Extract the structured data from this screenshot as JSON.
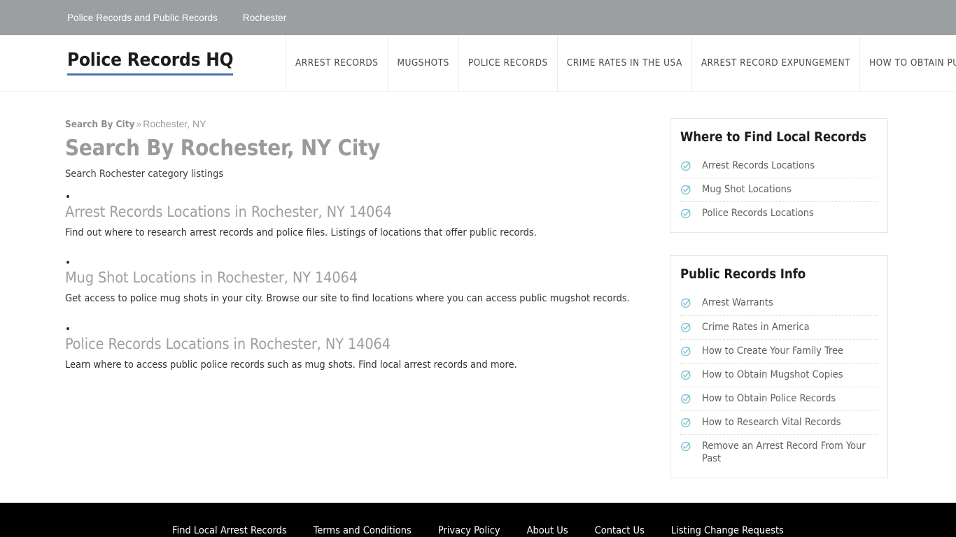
{
  "topbar": {
    "links": [
      {
        "label": "Police Records and Public Records"
      },
      {
        "label": "Rochester"
      }
    ]
  },
  "header": {
    "brand": "Police Records HQ",
    "brand_underline_color": "#4a73ab",
    "nav": [
      {
        "label": "ARREST RECORDS"
      },
      {
        "label": "MUGSHOTS"
      },
      {
        "label": "POLICE RECORDS"
      },
      {
        "label": "CRIME RATES IN THE USA"
      },
      {
        "label": "ARREST RECORD EXPUNGEMENT"
      },
      {
        "label": "HOW TO OBTAIN PUBLIC RECORDS"
      }
    ]
  },
  "main": {
    "breadcrumb": {
      "link": "Search By City",
      "separator": "»",
      "current": "Rochester, NY"
    },
    "title": "Search By Rochester, NY City",
    "subtitle": "Search Rochester category listings",
    "listings": [
      {
        "heading": "Arrest Records Locations in Rochester, NY 14064",
        "description": "Find out where to research arrest records and police files. Listings of locations that offer public records."
      },
      {
        "heading": "Mug Shot Locations in Rochester, NY 14064",
        "description": "Get access to police mug shots in your city. Browse our site to find locations where you can access public mugshot records."
      },
      {
        "heading": "Police Records Locations in Rochester, NY 14064",
        "description": "Learn where to access public police records such as mug shots. Find local arrest records and more."
      }
    ]
  },
  "sidebar": {
    "panels": [
      {
        "title": "Where to Find Local Records",
        "items": [
          {
            "label": "Arrest Records Locations",
            "icon": "check-circle-icon"
          },
          {
            "label": "Mug Shot Locations",
            "icon": "check-circle-icon"
          },
          {
            "label": "Police Records Locations",
            "icon": "check-circle-icon"
          }
        ]
      },
      {
        "title": "Public Records Info",
        "items": [
          {
            "label": "Arrest Warrants",
            "icon": "check-circle-icon"
          },
          {
            "label": "Crime Rates in America",
            "icon": "check-circle-icon"
          },
          {
            "label": "How to Create Your Family Tree",
            "icon": "check-circle-icon"
          },
          {
            "label": "How to Obtain Mugshot Copies",
            "icon": "check-circle-icon"
          },
          {
            "label": "How to Obtain Police Records",
            "icon": "check-circle-icon"
          },
          {
            "label": "How to Research Vital Records",
            "icon": "check-circle-icon"
          },
          {
            "label": "Remove an Arrest Record From Your Past",
            "icon": "check-circle-icon"
          }
        ]
      }
    ],
    "icon_color": "#7fc3d4"
  },
  "footer": {
    "links": [
      {
        "label": "Find Local Arrest Records"
      },
      {
        "label": "Terms and Conditions"
      },
      {
        "label": "Privacy Policy"
      },
      {
        "label": "About Us"
      },
      {
        "label": "Contact Us"
      },
      {
        "label": "Listing Change Requests"
      }
    ]
  },
  "colors": {
    "topbar_bg": "#9b9fa2",
    "footer_bg": "#000000",
    "accent_blue": "#4a73ab",
    "muted_text": "#9a9a9a"
  }
}
